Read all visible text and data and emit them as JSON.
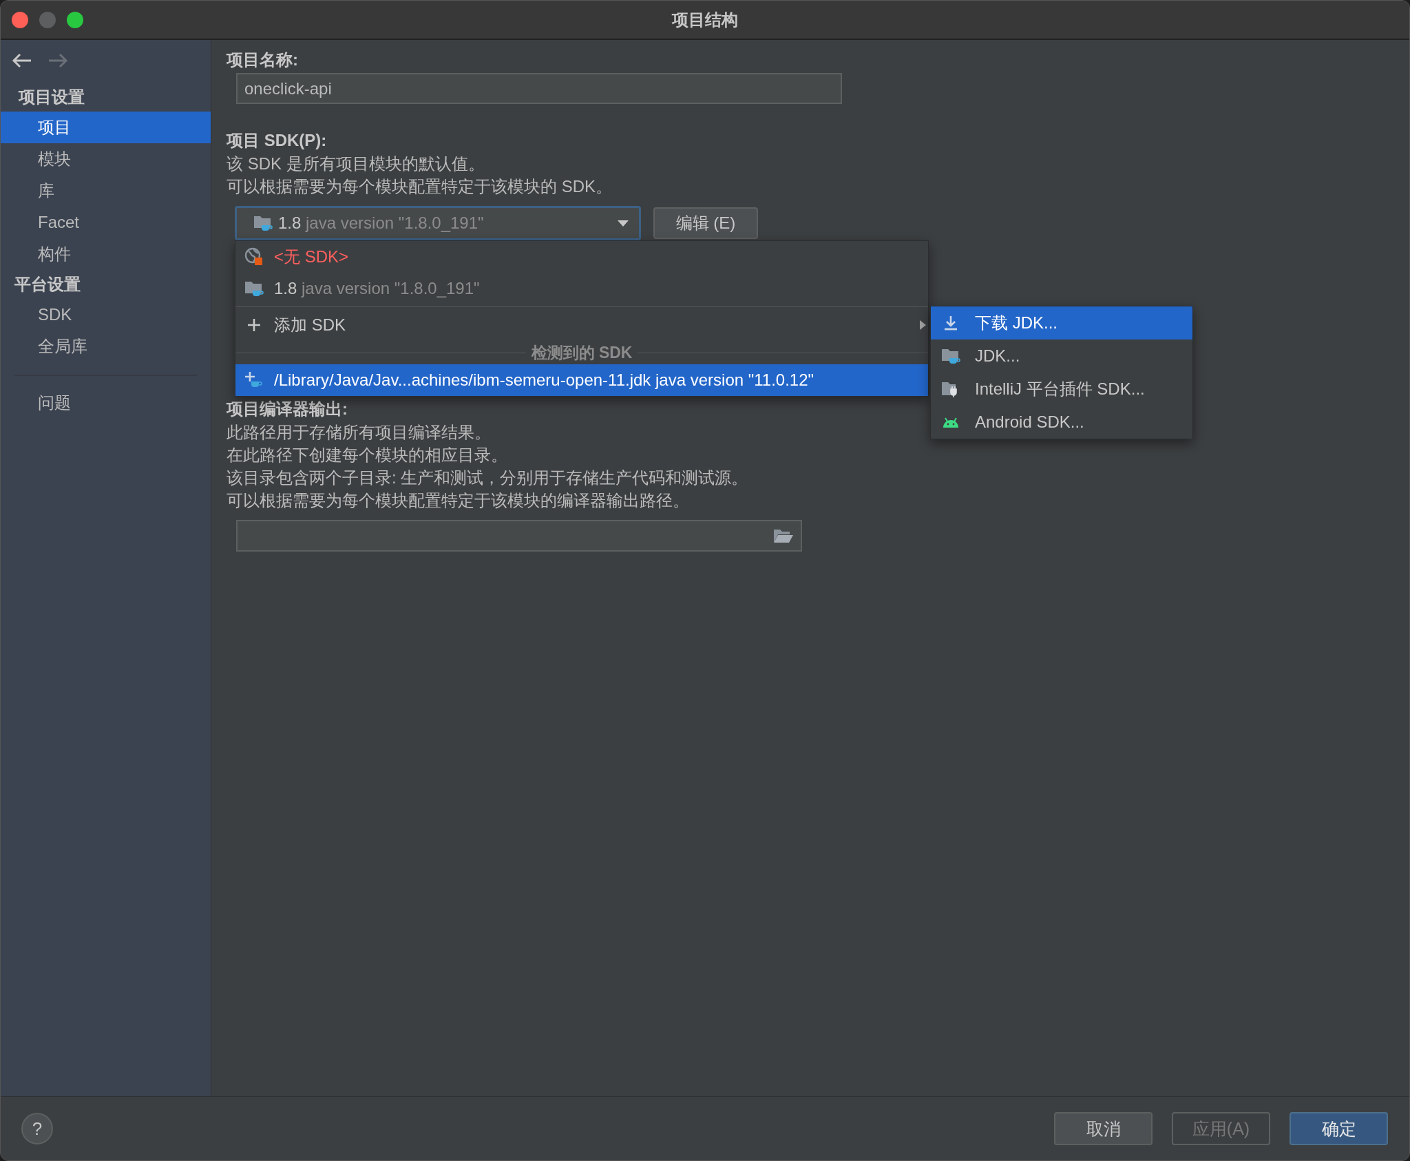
{
  "window": {
    "title": "项目结构"
  },
  "nav": {
    "back_enabled": true,
    "forward_enabled": false
  },
  "sidebar": {
    "sections": [
      {
        "title": "项目设置",
        "items": [
          {
            "label": "项目",
            "selected": true
          },
          {
            "label": "模块",
            "selected": false
          },
          {
            "label": "库",
            "selected": false
          },
          {
            "label": "Facet",
            "selected": false
          },
          {
            "label": "构件",
            "selected": false
          }
        ]
      },
      {
        "title": "平台设置",
        "items": [
          {
            "label": "SDK",
            "selected": false
          },
          {
            "label": "全局库",
            "selected": false
          }
        ]
      }
    ],
    "footer_items": [
      {
        "label": "问题",
        "selected": false
      }
    ]
  },
  "project_name": {
    "label": "项目名称:",
    "value": "oneclick-api"
  },
  "project_sdk": {
    "label": "项目 SDK(P):",
    "description": [
      "该 SDK 是所有项目模块的默认值。",
      "可以根据需要为每个模块配置特定于该模块的 SDK。"
    ],
    "combo": {
      "version": "1.8",
      "detail": "java version \"1.8.0_191\""
    },
    "edit_button": "编辑 (E)"
  },
  "compiler_output": {
    "label": "项目编译器输出:",
    "description": [
      "此路径用于存储所有项目编译结果。",
      "在此路径下创建每个模块的相应目录。",
      "该目录包含两个子目录: 生产和测试，分别用于存储生产代码和测试源。",
      "可以根据需要为每个模块配置特定于该模块的编译器输出路径。"
    ]
  },
  "sdk_popup": {
    "items": [
      {
        "kind": "none",
        "label": "<无 SDK>",
        "selected": false
      },
      {
        "kind": "jdk",
        "version": "1.8",
        "detail": "java version \"1.8.0_191\"",
        "selected": false
      },
      {
        "kind": "add",
        "label": "添加 SDK",
        "selected": false
      }
    ],
    "detected_header": "检测到的 SDK",
    "detected": [
      {
        "label": "/Library/Java/Jav...achines/ibm-semeru-open-11.jdk java version \"11.0.12\"",
        "selected": true
      }
    ]
  },
  "submenu": {
    "items": [
      {
        "kind": "download",
        "label": "下载 JDK...",
        "selected": true
      },
      {
        "kind": "jdk",
        "label": "JDK...",
        "selected": false
      },
      {
        "kind": "plugin",
        "label": "IntelliJ 平台插件 SDK...",
        "selected": false
      },
      {
        "kind": "android",
        "label": "Android SDK...",
        "selected": false
      }
    ]
  },
  "help_button": "?",
  "buttons": [
    {
      "label": "取消",
      "kind": "normal",
      "disabled": false
    },
    {
      "label": "应用(A)",
      "kind": "normal",
      "disabled": true
    },
    {
      "label": "确定",
      "kind": "default",
      "disabled": false
    }
  ]
}
